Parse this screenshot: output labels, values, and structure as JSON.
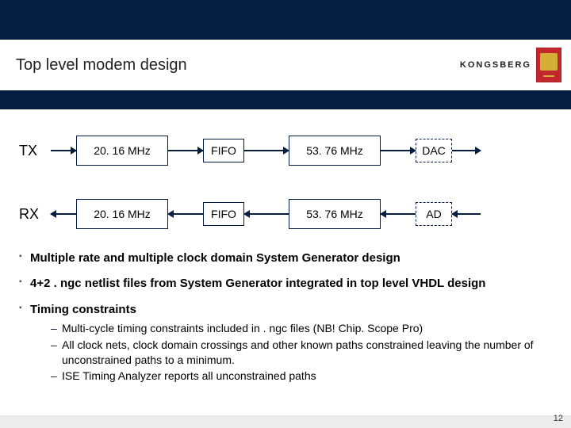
{
  "header": {
    "title": "Top level modem design",
    "brand": "KONGSBERG"
  },
  "diagram": {
    "rows": [
      {
        "label": "TX",
        "clk1": "20. 16 MHz",
        "fifo": "FIFO",
        "clk2": "53. 76 MHz",
        "end": "DAC",
        "dir": "r"
      },
      {
        "label": "RX",
        "clk1": "20. 16 MHz",
        "fifo": "FIFO",
        "clk2": "53. 76 MHz",
        "end": "AD",
        "dir": "l"
      }
    ]
  },
  "bullets": {
    "b1": "Multiple rate and multiple clock domain System Generator design",
    "b2": "4+2 . ngc netlist files from System Generator integrated in top level VHDL design",
    "b3": "Timing constraints",
    "b3s": {
      "a": "Multi-cycle timing constraints included in . ngc files (NB! Chip. Scope Pro)",
      "b": "All clock nets, clock domain crossings and other known paths constrained leaving the number of unconstrained paths to a minimum.",
      "c": "ISE Timing Analyzer reports all unconstrained paths"
    }
  },
  "page": "12"
}
